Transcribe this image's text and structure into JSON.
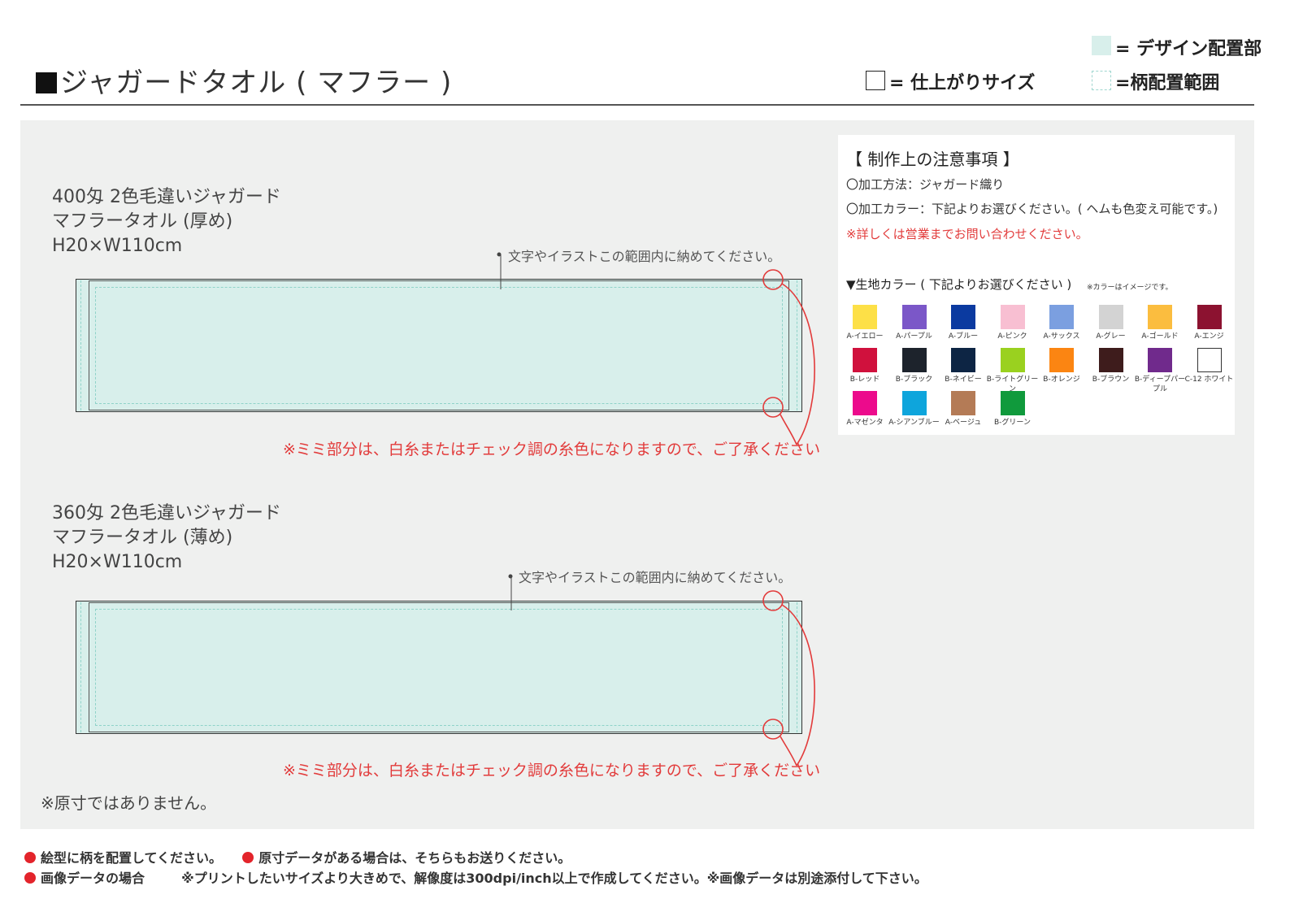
{
  "header": {
    "title": "ジャガードタオル ( マフラー )"
  },
  "legend": {
    "design_area": "= デザイン配置部",
    "finished_size": "= 仕上がりサイズ",
    "pattern_area": "=柄配置範囲"
  },
  "colors": {
    "design_fill": "#d8efeb",
    "panel_bg": "#eff0ef",
    "red": "#e23b3b"
  },
  "products": [
    {
      "lines": [
        "400匁 2色毛違いジャガード",
        "マフラータオル (厚め)",
        "H20×W110cm"
      ],
      "area_note": "文字やイラストこの範囲内に納めてください。",
      "mimi_note": "※ミミ部分は、白糸またはチェック調の糸色になりますので、ご了承ください"
    },
    {
      "lines": [
        "360匁 2色毛違いジャガード",
        "マフラータオル (薄め)",
        "H20×W110cm"
      ],
      "area_note": "文字やイラストこの範囲内に納めてください。",
      "mimi_note": "※ミミ部分は、白糸またはチェック調の糸色になりますので、ご了承ください"
    }
  ],
  "not_actual_size": "※原寸ではありません。",
  "info": {
    "title": "【 制作上の注意事項 】",
    "method": "〇加工方法：ジャガード織り",
    "color": "〇加工カラー：下記よりお選びください。( ヘムも色変え可能です。)",
    "contact": "※詳しくは営業までお問い合わせください。",
    "fabric_title": "▼生地カラー ( 下記よりお選びください )",
    "image_note": "※カラーはイメージです。",
    "swatches": [
      {
        "label": "A-イエロー",
        "color": "#fde047"
      },
      {
        "label": "A-パープル",
        "color": "#7b57c8"
      },
      {
        "label": "A-ブルー",
        "color": "#0b3aa0"
      },
      {
        "label": "A-ピンク",
        "color": "#f8bfd2"
      },
      {
        "label": "A-サックス",
        "color": "#7b9fe0"
      },
      {
        "label": "A-グレー",
        "color": "#d3d3d3"
      },
      {
        "label": "A-ゴールド",
        "color": "#fbbd3f"
      },
      {
        "label": "A-エンジ",
        "color": "#8c1230"
      },
      {
        "label": "B-レッド",
        "color": "#d0113d"
      },
      {
        "label": "B-ブラック",
        "color": "#1d232c"
      },
      {
        "label": "B-ネイビー",
        "color": "#0d2544"
      },
      {
        "label": "B-ライトグリーン",
        "color": "#9ad11f"
      },
      {
        "label": "B-オレンジ",
        "color": "#fb8512"
      },
      {
        "label": "B-ブラウン",
        "color": "#3e1c1c"
      },
      {
        "label": "B-ディープパープル",
        "color": "#702a8c"
      },
      {
        "label": "C-12 ホワイト",
        "color": "#ffffff"
      },
      {
        "label": "A-マゼンタ",
        "color": "#ec0b8c"
      },
      {
        "label": "A-シアンブルー",
        "color": "#0ea5dc"
      },
      {
        "label": "A-ベージュ",
        "color": "#b47b56"
      },
      {
        "label": "B-グリーン",
        "color": "#109a3c"
      }
    ]
  },
  "footer": {
    "line1a": "絵型に柄を配置してください。",
    "line1b": "原寸データがある場合は、そちらもお送りください。",
    "line2a": "画像データの場合",
    "line2b": "※プリントしたいサイズより大きめで、解像度は300dpi/inch以上で作成してください。※画像データは別途添付して下さい。"
  }
}
